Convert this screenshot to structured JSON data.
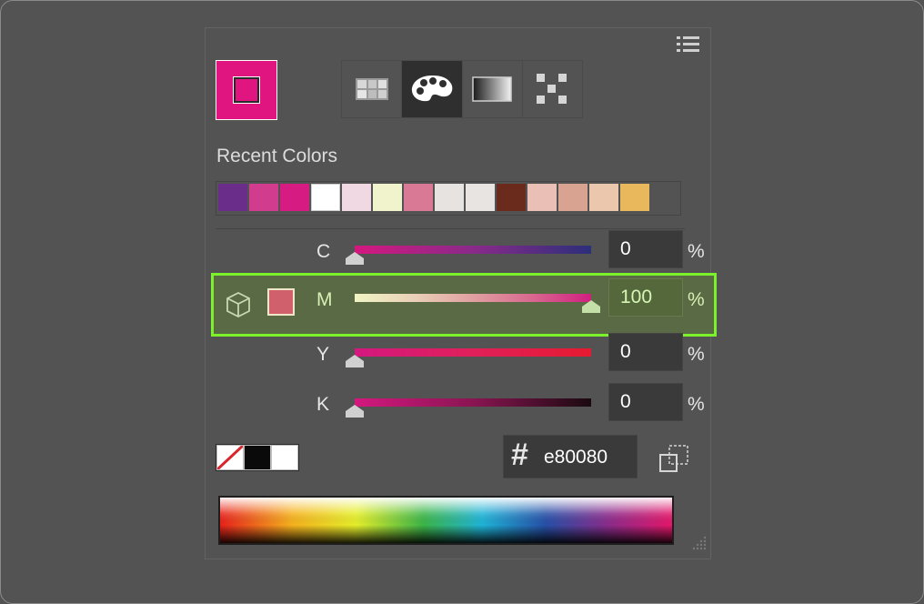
{
  "panel": {
    "fill_color": "#e0157f",
    "menu_icon": "hamburger-list-icon",
    "mode_tabs": [
      {
        "name": "swatches-grid",
        "icon": "swatch-grid-icon",
        "active": false
      },
      {
        "name": "color-palette",
        "icon": "palette-icon",
        "active": true
      },
      {
        "name": "gradient",
        "icon": "gradient-icon",
        "active": false
      },
      {
        "name": "pattern",
        "icon": "pattern-icon",
        "active": false
      }
    ]
  },
  "recent": {
    "label": "Recent Colors",
    "swatches": [
      "#6a2e8a",
      "#d23c8e",
      "#d61c82",
      "#ffffff",
      "#f0d9e3",
      "#f1f3cd",
      "#d97996",
      "#e7e3e0",
      "#e8e4e1",
      "#6b2b1c",
      "#eabfb5",
      "#d9a392",
      "#ebc8ad",
      "#e9b75c"
    ]
  },
  "sliders": [
    {
      "label": "C",
      "value": "0",
      "unit": "%",
      "level": 0,
      "highlight": false,
      "track": "linear-gradient(to right,#d4187f,#8a2a8a,#2c2f7a)"
    },
    {
      "label": "M",
      "value": "100",
      "unit": "%",
      "level": 1,
      "highlight": true,
      "track": "linear-gradient(to right,#f0f4c4,#ead0b8,#e0a0a0,#d86890,#d11f80)"
    },
    {
      "label": "Y",
      "value": "0",
      "unit": "%",
      "level": 0,
      "highlight": false,
      "track": "linear-gradient(to right,#d4187f,#e0205a,#e61a30)"
    },
    {
      "label": "K",
      "value": "0",
      "unit": "%",
      "level": 0,
      "highlight": false,
      "track": "linear-gradient(to right,#d4187f,#8a1552,#1a0a10)"
    }
  ],
  "hex": {
    "hash": "#",
    "value": "e80080"
  },
  "highlight_swatch": "#d0606c",
  "icons": {
    "cube": "cube-icon",
    "none_swatch": "none-swatch-icon",
    "gamut": "gamut-warning-icon",
    "grip": "resize-grip-icon"
  }
}
